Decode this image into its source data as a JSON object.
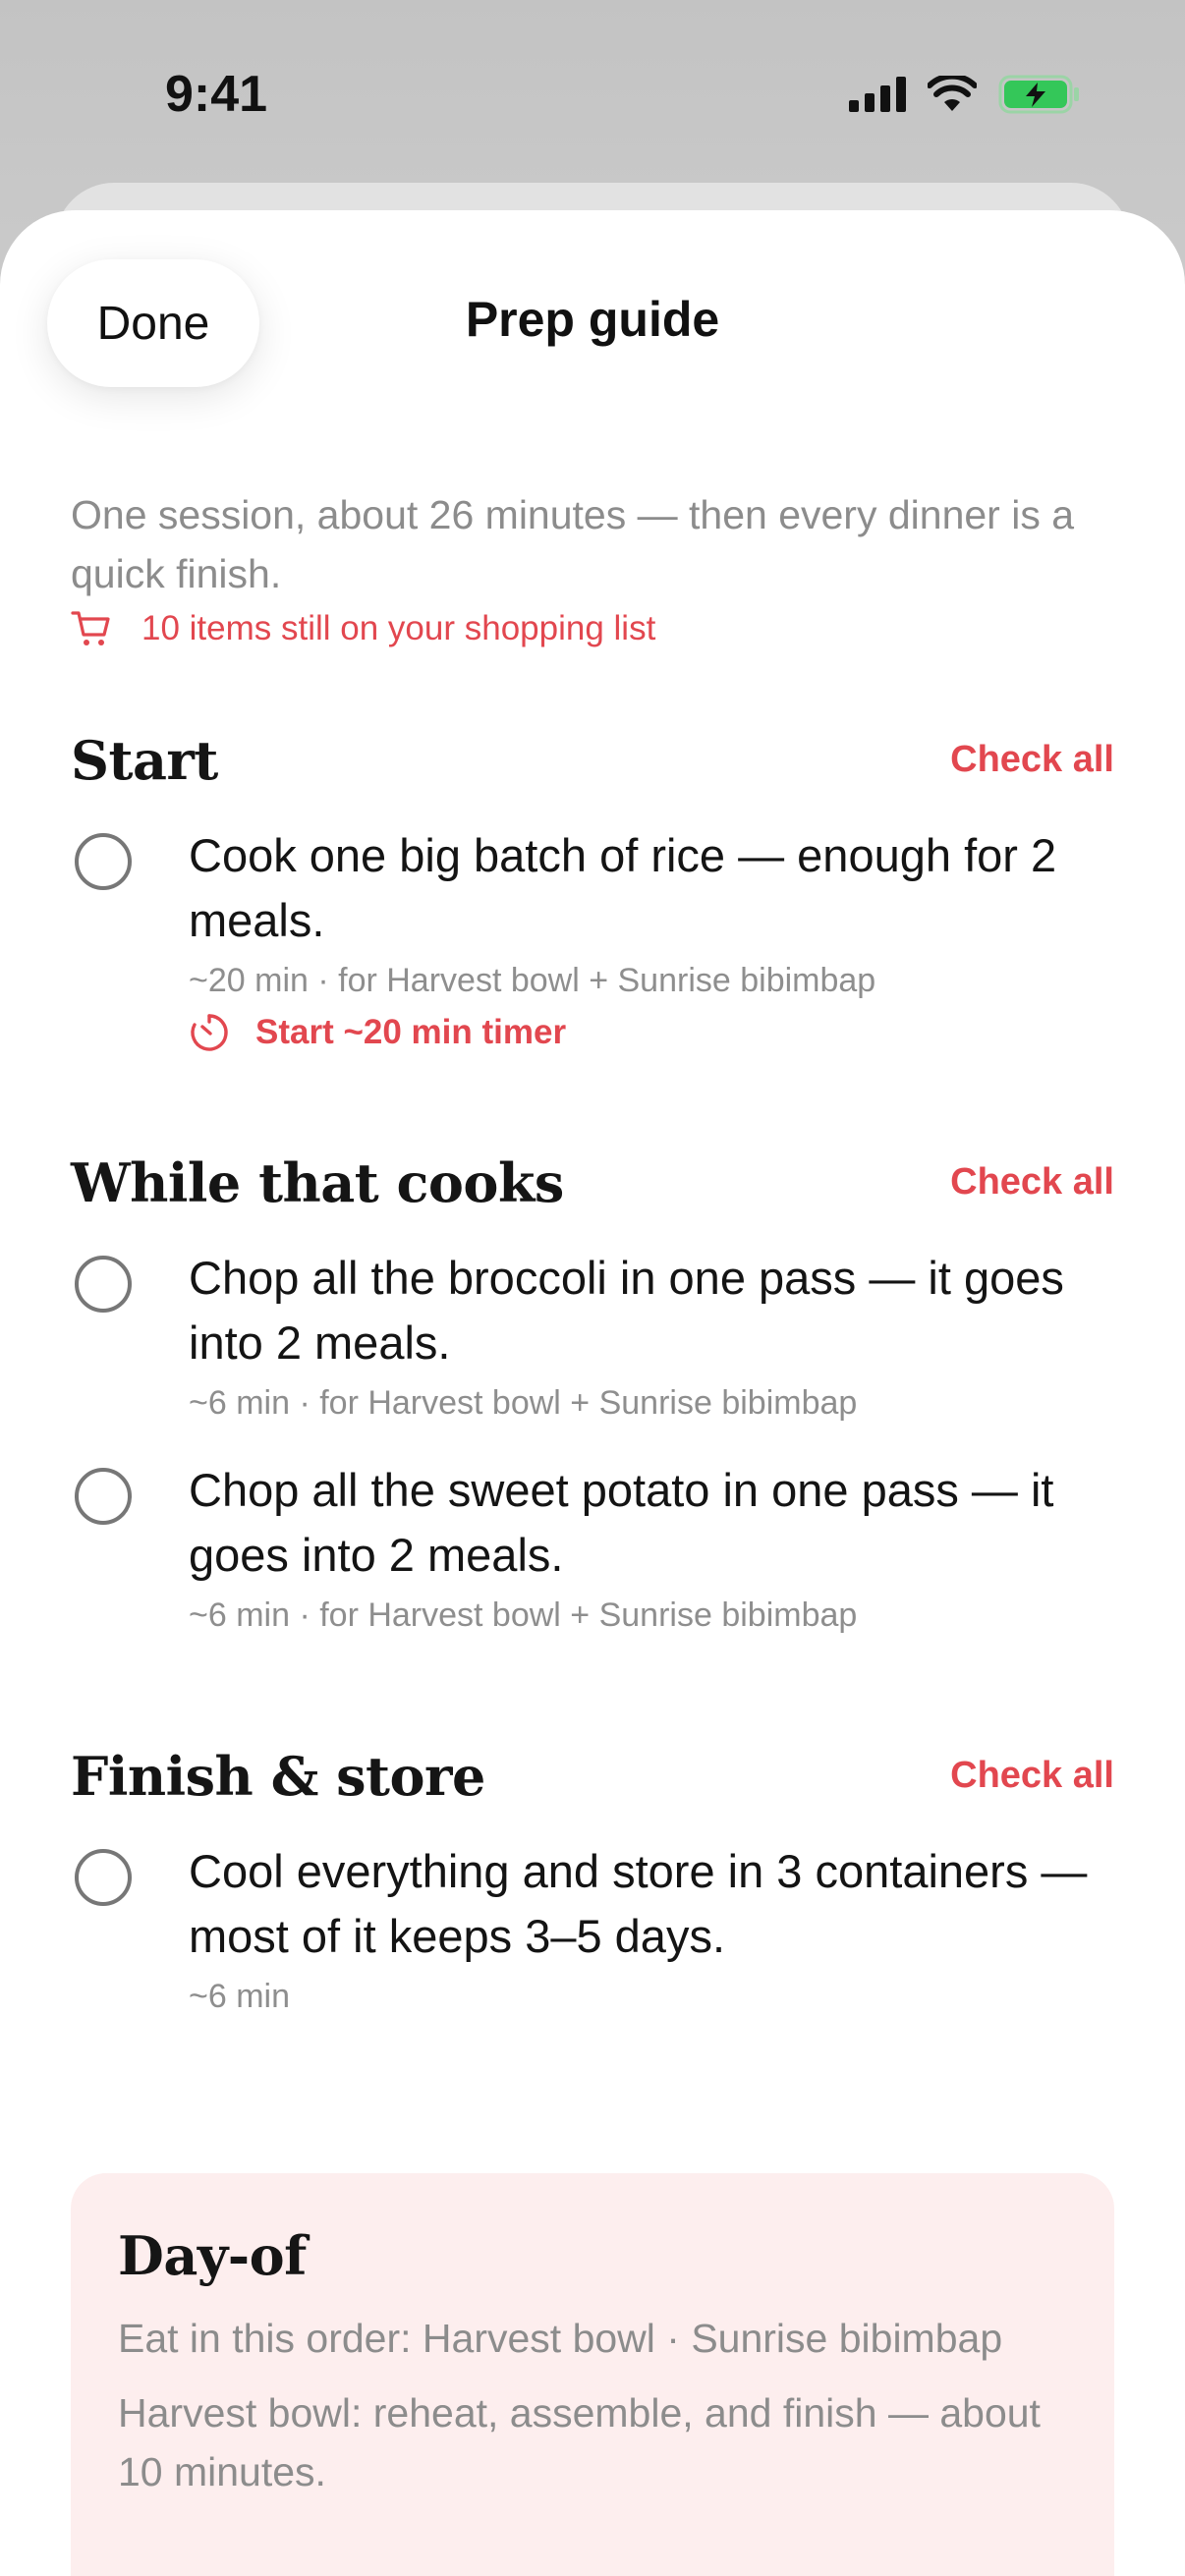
{
  "status_bar": {
    "time": "9:41"
  },
  "header": {
    "done_label": "Done",
    "title": "Prep guide"
  },
  "intro": {
    "text": "One session, about 26 minutes — then every dinner is a quick finish.",
    "shopping_notice": "10 items still on your shopping list"
  },
  "sections": [
    {
      "title": "Start",
      "check_all": "Check all",
      "tasks": [
        {
          "text": "Cook one big batch of rice — enough for 2 meals.",
          "meta": "~20 min · for Harvest bowl + Sunrise bibimbap",
          "timer": "Start ~20 min timer"
        }
      ]
    },
    {
      "title": "While that cooks",
      "check_all": "Check all",
      "tasks": [
        {
          "text": "Chop all the broccoli in one pass — it goes into 2 meals.",
          "meta": "~6 min · for Harvest bowl + Sunrise bibimbap"
        },
        {
          "text": "Chop all the sweet potato in one pass — it goes into 2 meals.",
          "meta": "~6 min · for Harvest bowl + Sunrise bibimbap"
        }
      ]
    },
    {
      "title": "Finish & store",
      "check_all": "Check all",
      "tasks": [
        {
          "text": "Cool everything and store in 3 containers — most of it keeps 3–5 days.",
          "meta": "~6 min"
        }
      ]
    }
  ],
  "day_of": {
    "title": "Day-of",
    "order": "Eat in this order: Harvest bowl · Sunrise bibimbap",
    "detail": "Harvest bowl: reheat, assemble, and finish — about 10 minutes."
  },
  "colors": {
    "accent": "#e2474f",
    "muted_text": "#8c8c8c",
    "card_bg": "#fdeeee",
    "battery_green": "#34c759"
  },
  "icons": [
    "signal-icon",
    "wifi-icon",
    "battery-icon",
    "cart-icon",
    "timer-icon",
    "checkbox-circle-icon"
  ]
}
